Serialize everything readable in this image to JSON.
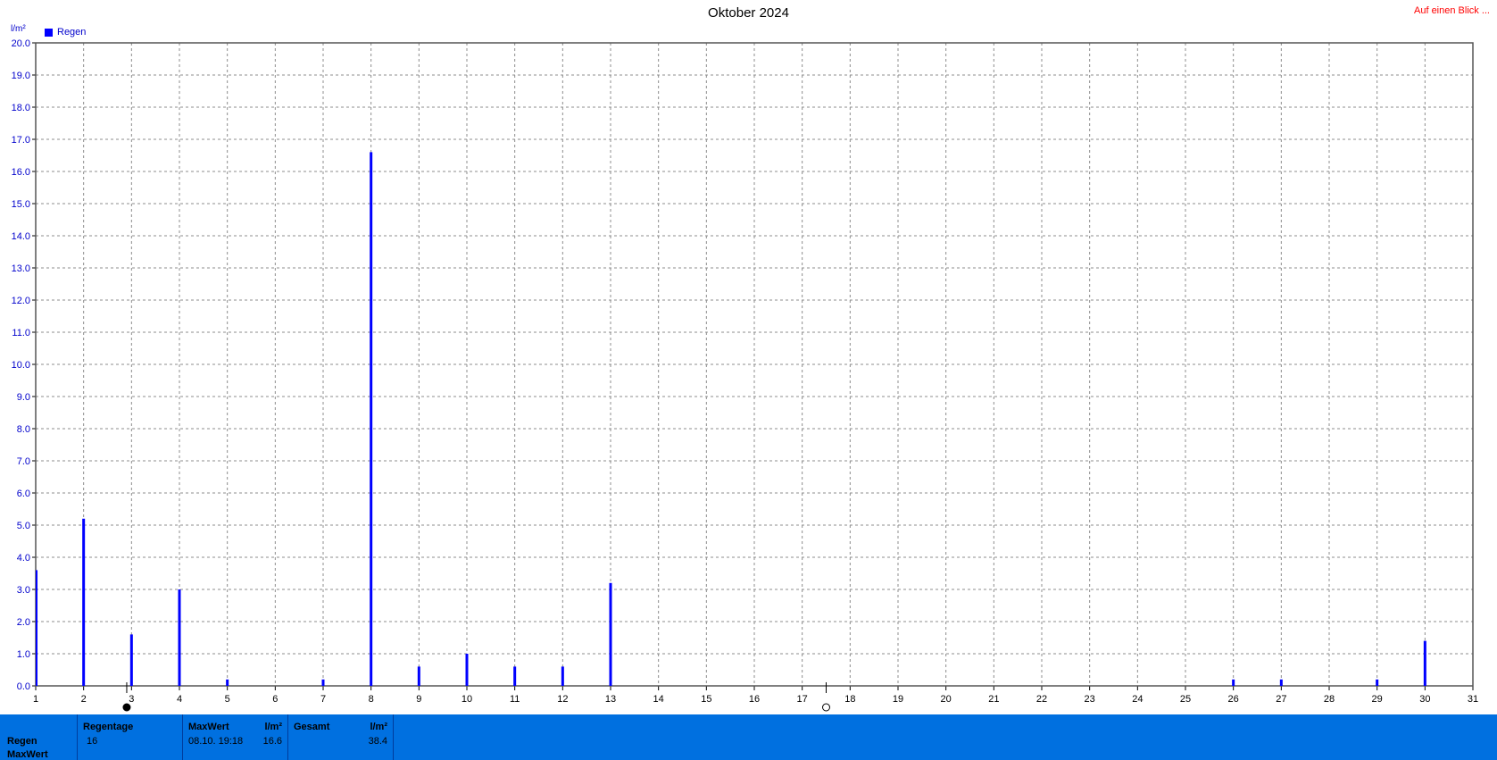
{
  "header": {
    "title": "Oktober 2024",
    "link": "Auf einen Blick ...",
    "y_unit": "l/m²"
  },
  "chart_data": {
    "type": "bar",
    "title": "Oktober 2024",
    "ylabel": "l/m²",
    "xlabel": "",
    "ylim": [
      0,
      20
    ],
    "xlim": [
      1,
      31
    ],
    "grid": true,
    "legend_position": "top-left",
    "x_ticks": [
      1,
      2,
      3,
      4,
      5,
      6,
      7,
      8,
      9,
      10,
      11,
      12,
      13,
      14,
      15,
      16,
      17,
      18,
      19,
      20,
      21,
      22,
      23,
      24,
      25,
      26,
      27,
      28,
      29,
      30,
      31
    ],
    "y_ticks": [
      "0.0",
      "1.0",
      "2.0",
      "3.0",
      "4.0",
      "5.0",
      "6.0",
      "7.0",
      "8.0",
      "9.0",
      "10.0",
      "11.0",
      "12.0",
      "13.0",
      "14.0",
      "15.0",
      "16.0",
      "17.0",
      "18.0",
      "19.0",
      "20.0"
    ],
    "series": [
      {
        "name": "Regen",
        "color": "#0000ff",
        "x": [
          1,
          2,
          3,
          4,
          5,
          7,
          8,
          9,
          10,
          11,
          12,
          13,
          26,
          27,
          29,
          30
        ],
        "values": [
          3.6,
          5.2,
          1.6,
          3.0,
          0.2,
          0.2,
          16.6,
          0.6,
          1.0,
          0.6,
          0.6,
          3.2,
          0.2,
          0.2,
          0.2,
          1.4
        ]
      }
    ],
    "moon_phases": [
      {
        "day": 2.9,
        "phase": "new-moon"
      },
      {
        "day": 17.5,
        "phase": "full-moon"
      }
    ]
  },
  "footer": {
    "row_labels": [
      "Regen",
      "MaxWert"
    ],
    "regentage": {
      "label": "Regentage",
      "value": "16"
    },
    "maxwert": {
      "label": "MaxWert",
      "unit": "l/m²",
      "date": "08.10.  19:18",
      "value": "16.6"
    },
    "gesamt": {
      "label": "Gesamt",
      "unit": "l/m²",
      "value": "38.4"
    }
  }
}
